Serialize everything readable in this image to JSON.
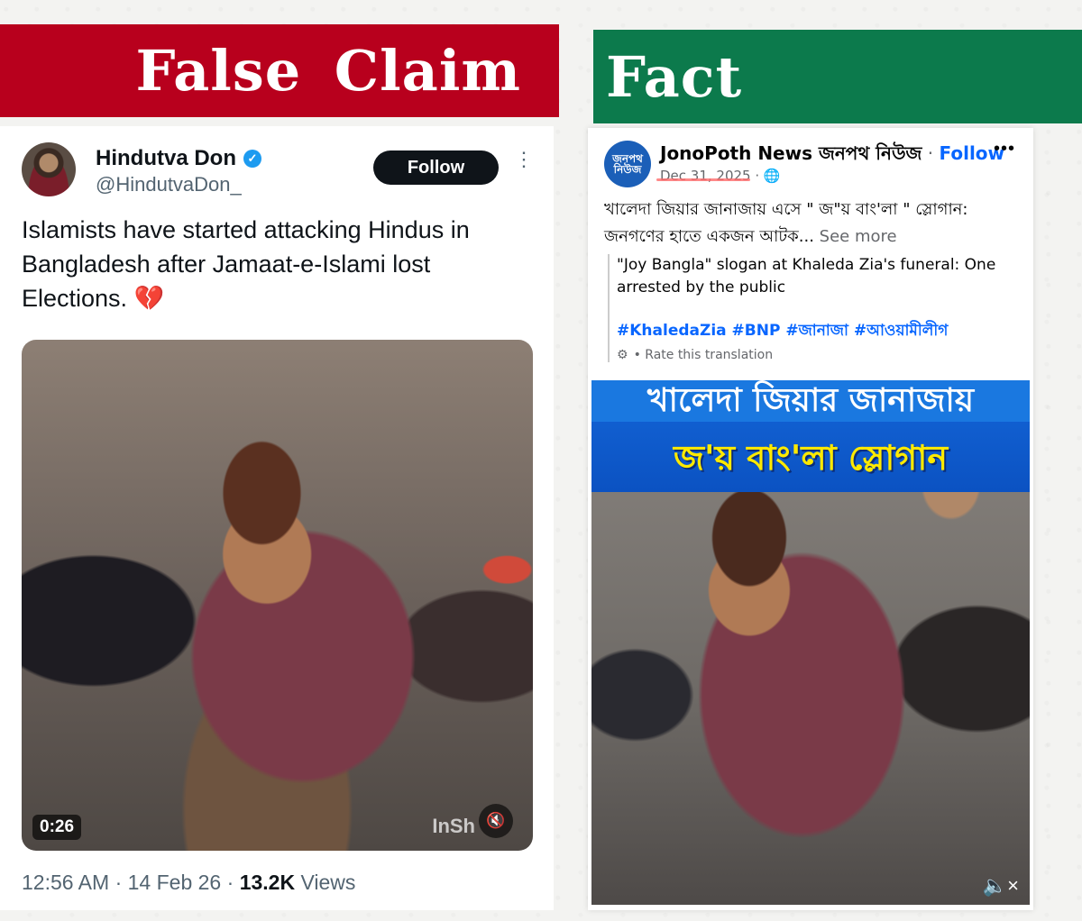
{
  "banners": {
    "false_claim": "False Claim",
    "fact": "Fact"
  },
  "tweet": {
    "name": "Hindutva Don",
    "handle": "@HindutvaDon_",
    "follow_label": "Follow",
    "more_icon": "⋮",
    "verified_icon": "✓",
    "text": "Islamists have started attacking Hindus in Bangladesh after Jamaat-e-Islami lost Elections. 💔",
    "video": {
      "duration": "0:26",
      "mute_icon": "🔇",
      "watermark": "InSh"
    },
    "meta": {
      "time": "12:56 AM",
      "sep": " · ",
      "date": "14 Feb 26",
      "views_count": "13.2K",
      "views_label": " Views"
    }
  },
  "fb_post": {
    "avatar_text": "জনপথ নিউজ",
    "page_name": "JonoPoth News জনপথ নিউজ",
    "dot": " · ",
    "follow_label": "Follow",
    "more_icon": "•••",
    "date": "Dec 31, 2025",
    "privacy_icon": "· 🌐",
    "text": "খালেদা জিয়ার জানাজায় এসে \" জ\"য় বাং'লা \" স্লোগান: জনগণের হাতে একজন আটক...",
    "see_more": " See more",
    "translation": "\"Joy Bangla\" slogan at Khaleda Zia's funeral: One arrested by the public",
    "hashtags": "#KhaledaZia #BNP #জানাজা #আওয়ামীলীগ",
    "rate_icon": "⚙",
    "rate_label": "• Rate this translation",
    "media": {
      "headline_1": "খালেদা জিয়ার জানাজায়",
      "headline_2": "জ'য় বাং'লা স্লোগান",
      "mute_icon": "🔈×"
    }
  }
}
